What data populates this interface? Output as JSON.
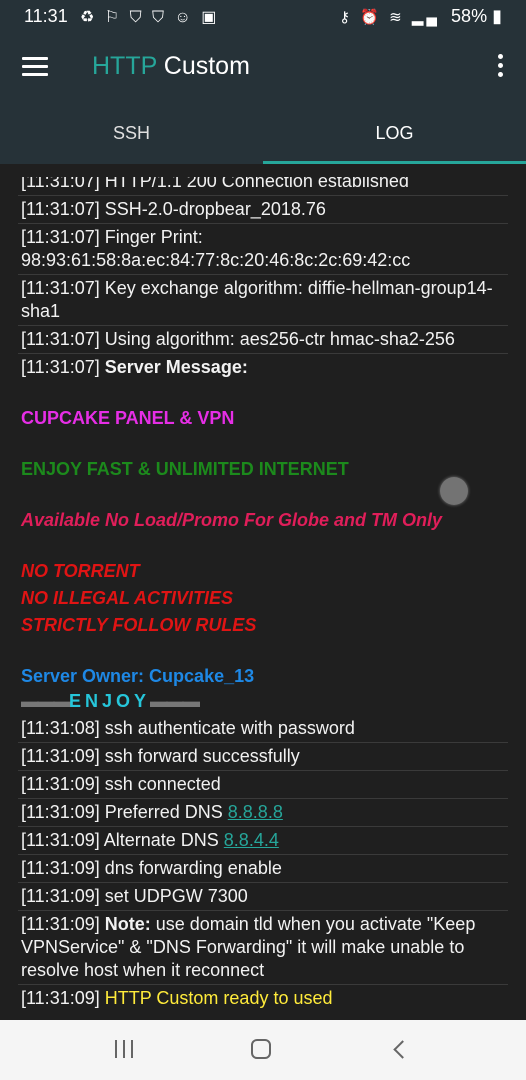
{
  "status_bar": {
    "time": "11:31",
    "left_icons": "♻ ⚐ ⛉ ⛉ ☺ ▣",
    "right_icons": "⚷ ⏰ ≋ ▂▄",
    "battery": "58%",
    "battery_icon": "▮"
  },
  "app_bar": {
    "title_accent": "HTTP",
    "title_rest": " Custom"
  },
  "tabs": [
    {
      "label": "SSH"
    },
    {
      "label": "LOG"
    }
  ],
  "log": {
    "lines": [
      "[11:31:07] HTTP/1.1 200 Connection established",
      "[11:31:07] SSH-2.0-dropbear_2018.76",
      "[11:31:07] Finger Print: 98:93:61:58:8a:ec:84:77:8c:20:46:8c:2c:69:42:cc",
      "[11:31:07] Key exchange algorithm: diffie-hellman-group14-sha1",
      "[11:31:07] Using algorithm: aes256-ctr hmac-sha2-256"
    ],
    "server_message_time": "[11:31:07] ",
    "server_message_label": "Server Message:",
    "message": {
      "panel": "CUPCAKE PANEL & VPN",
      "enjoy_fast": "ENJOY FAST & UNLIMITED INTERNET",
      "available": "Available No Load/Promo For Globe and TM Only",
      "no_torrent": "NO TORRENT",
      "no_illegal": "NO ILLEGAL ACTIVITIES",
      "follow_rules": "STRICTLY FOLLOW RULES",
      "owner": "Server Owner: Cupcake_13",
      "enjoy_deco": "▬▬▬",
      "enjoy": "ENJOY",
      "enjoy_deco_right": "▬▬▬"
    },
    "lines_after": [
      "[11:31:08] ssh authenticate with password",
      "[11:31:09] ssh forward successfully",
      "[11:31:09] ssh connected"
    ],
    "preferred_dns_prefix": "[11:31:09] Preferred DNS ",
    "preferred_dns": "8.8.8.8",
    "alternate_dns_prefix": "[11:31:09] Alternate DNS ",
    "alternate_dns": "8.8.4.4",
    "lines_after_dns": [
      "[11:31:09] dns forwarding enable",
      "[11:31:09] set UDPGW 7300"
    ],
    "note_time": "[11:31:09] ",
    "note_label": "Note:",
    "note_text": " use domain tld when you activate \"Keep VPNService\" & \"DNS Forwarding\" it will make unable to resolve host when it reconnect",
    "ready_time": "[11:31:09] ",
    "ready_text": "HTTP Custom ready to used"
  },
  "colors": {
    "accent": "#26a69a",
    "app_bar": "#263238",
    "log_background": "#1f1f1f",
    "ready": "#ffeb3b"
  }
}
